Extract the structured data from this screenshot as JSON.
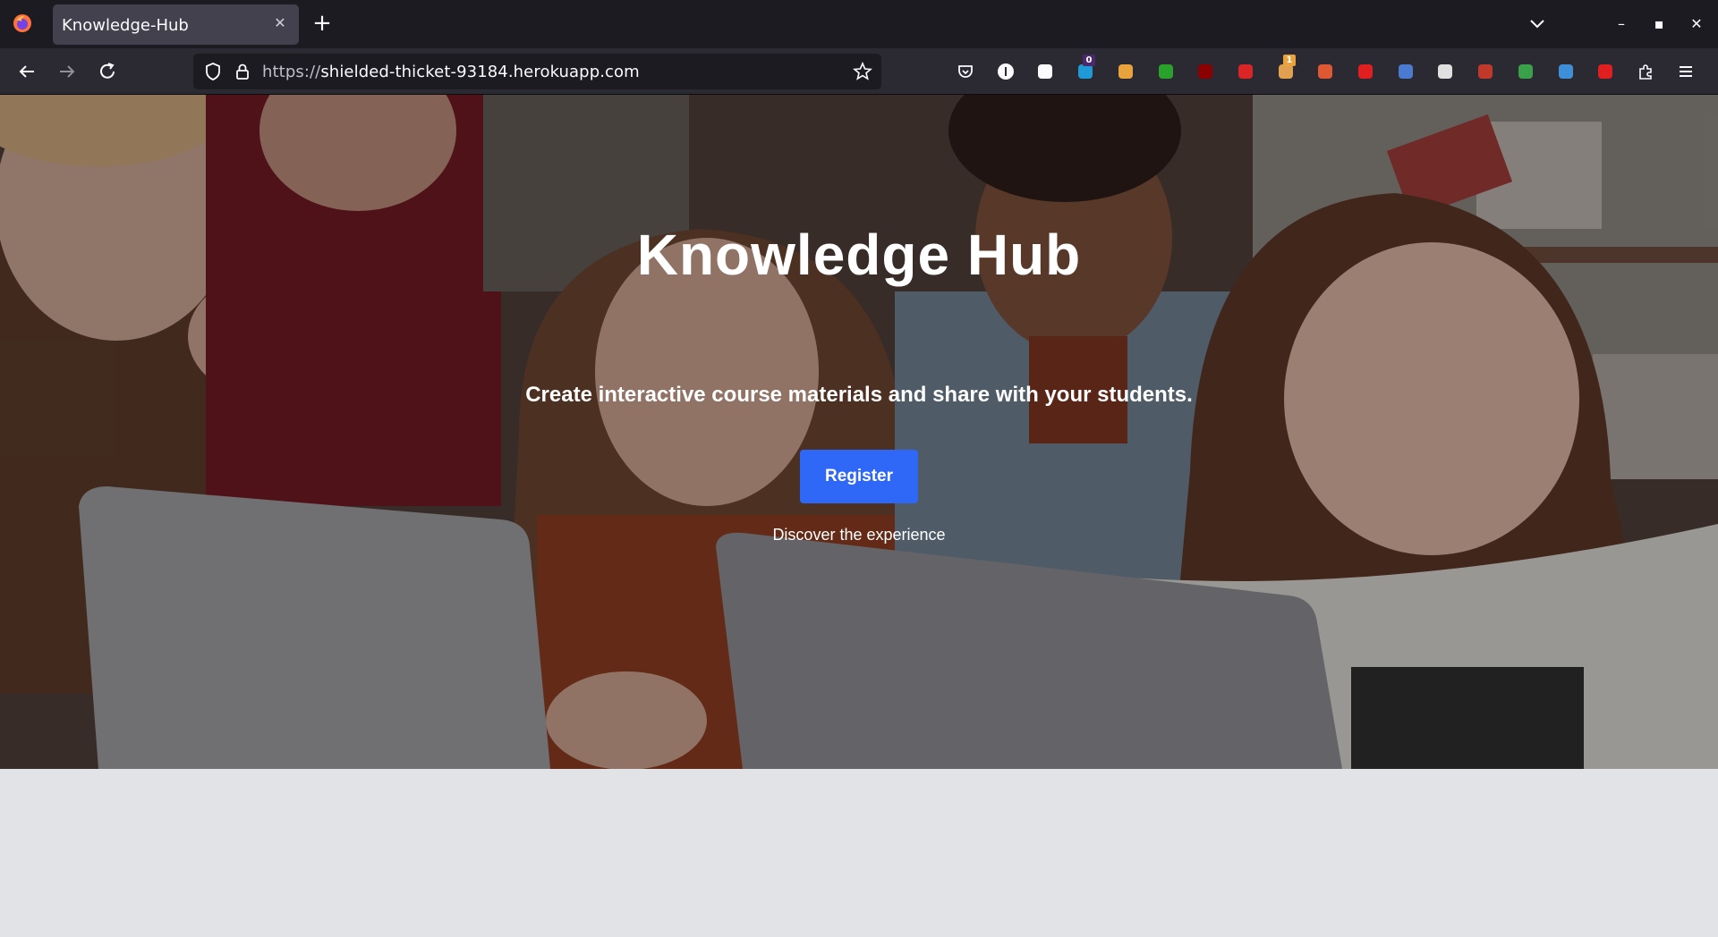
{
  "browser": {
    "tab": {
      "title": "Knowledge-Hub",
      "close_glyph": "✕"
    },
    "new_tab_glyph": "+",
    "window_controls": {
      "minimize": "–",
      "maximize": "▪",
      "close": "✕"
    },
    "url": {
      "protocol": "https://",
      "host": "shielded-thicket-93184.herokuapp.com"
    },
    "extensions": [
      {
        "name": "pocket-icon",
        "color": "#fbfbfe"
      },
      {
        "name": "info-icon",
        "color": "#fbfbfe"
      },
      {
        "name": "paw-icon",
        "color": "#fbfbfe"
      },
      {
        "name": "ghost-badge-icon",
        "color": "#1e9bd7",
        "badge": "0"
      },
      {
        "name": "dots-icon",
        "color": "#e8a33c"
      },
      {
        "name": "download-arrow-icon",
        "color": "#2aa12a"
      },
      {
        "name": "ublock-icon",
        "color": "#8b0000"
      },
      {
        "name": "wand-icon",
        "color": "#d92525"
      },
      {
        "name": "hand-badge-icon",
        "color": "#e0a050",
        "badge": "1"
      },
      {
        "name": "duckduckgo-icon",
        "color": "#de5833"
      },
      {
        "name": "lock-red-icon",
        "color": "#e02020"
      },
      {
        "name": "list-icon",
        "color": "#4a7bd0"
      },
      {
        "name": "hd-icon",
        "color": "#e0e0e0"
      },
      {
        "name": "yd-icon",
        "color": "#c0392b"
      },
      {
        "name": "gem-icon",
        "color": "#3aa04a"
      },
      {
        "name": "camera-icon",
        "color": "#3f8fd8"
      },
      {
        "name": "save-red-icon",
        "color": "#e02020"
      },
      {
        "name": "puzzle-icon",
        "color": "#fbfbfe"
      },
      {
        "name": "menu-icon",
        "color": "#fbfbfe"
      }
    ]
  },
  "hero": {
    "title": "Knowledge Hub",
    "subtitle": "Create interactive course materials and share with your students.",
    "register_label": "Register",
    "discover_text": "Discover the experience"
  },
  "colors": {
    "accent": "#2f67f6",
    "page_bg": "#e1e3e7"
  }
}
